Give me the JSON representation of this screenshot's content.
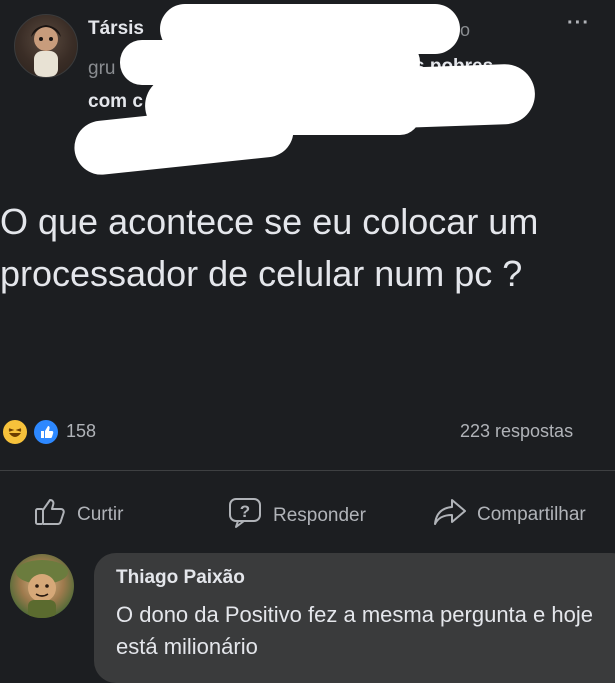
{
  "post": {
    "author_visible": "Társis",
    "line1_tail": "o",
    "line2_start": "gru",
    "line2_end": "s pobres",
    "line3_start": "com c",
    "more_label": "···",
    "text": "O que acontece se eu colocar um processador de celular num pc ?",
    "reactions_count": "158",
    "replies_count": "223 respostas"
  },
  "actions": {
    "like": "Curtir",
    "reply": "Responder",
    "share": "Compartilhar"
  },
  "comment": {
    "author": "Thiago Paixão",
    "text": "O dono da Positivo fez a mesma pergunta e hoje está milionário"
  },
  "colors": {
    "background": "#1c1e21",
    "text": "#e4e6eb",
    "muted": "#b0b3b8",
    "like_blue": "#2d88ff",
    "haha_yellow": "#f7c23b",
    "bubble": "#3a3b3c"
  }
}
